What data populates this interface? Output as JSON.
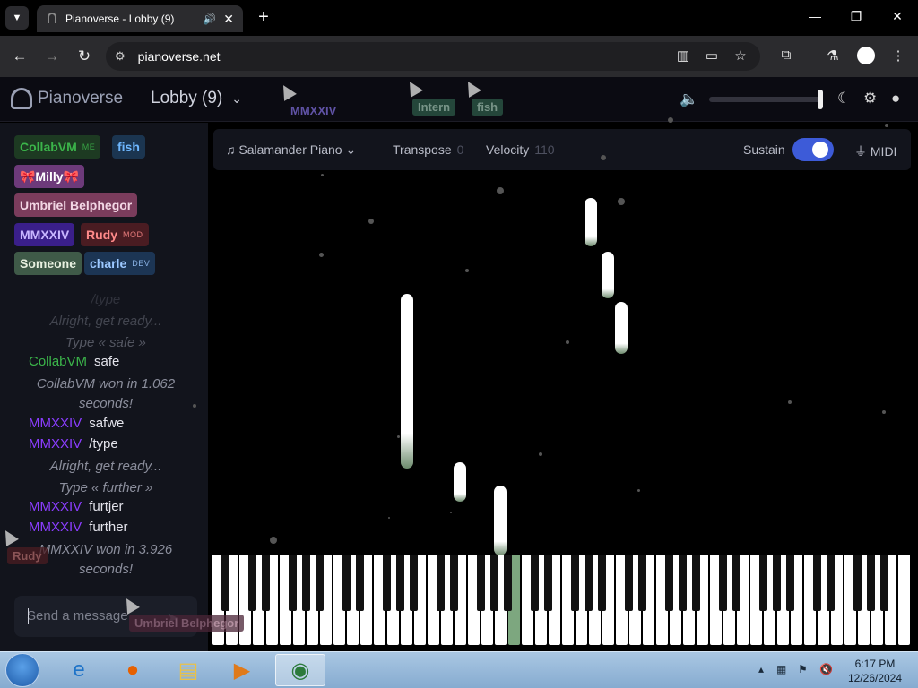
{
  "browser": {
    "tab_title": "Pianoverse - Lobby (9)",
    "url": "pianoverse.net",
    "new_tab_label": "+",
    "min_label": "—",
    "restore_label": "❐",
    "close_label": "✕"
  },
  "app": {
    "brand": "Pianoverse",
    "room": "Lobby (9)"
  },
  "users": [
    {
      "name": "CollabVM",
      "tag": "ME",
      "color": "#3bb44a",
      "bg": "#1d3a22"
    },
    {
      "name": "fish",
      "tag": "",
      "color": "#6fb8ff",
      "bg": "#1b3550"
    },
    {
      "name": "🎀Milly🎀",
      "tag": "",
      "color": "#ffffff",
      "bg": "#6d3a7a"
    },
    {
      "name": "Umbriel Belphegor",
      "tag": "",
      "color": "#f2d6e4",
      "bg": "#7a3c5c"
    },
    {
      "name": "MMXXIV",
      "tag": "",
      "color": "#c8b6ff",
      "bg": "#3a1f8a"
    },
    {
      "name": "Rudy",
      "tag": "MOD",
      "color": "#ff8a8a",
      "bg": "#4a1c22"
    },
    {
      "name": "Someone",
      "tag": "",
      "color": "#e8f0e0",
      "bg": "#3f5a48"
    },
    {
      "name": "charle",
      "tag": "DEV",
      "color": "#9cc8ff",
      "bg": "#1c3554"
    }
  ],
  "chat": {
    "faded": [
      "/type",
      "Alright, get ready...",
      "Type « safe »"
    ],
    "messages": [
      {
        "kind": "msg",
        "user": "CollabVM",
        "color": "#3bb44a",
        "text": "safe"
      },
      {
        "kind": "sys",
        "text": "CollabVM won in 1.062 seconds!"
      },
      {
        "kind": "msg",
        "user": "MMXXIV",
        "color": "#8b3dff",
        "text": "safwe"
      },
      {
        "kind": "msg",
        "user": "MMXXIV",
        "color": "#8b3dff",
        "text": "/type"
      },
      {
        "kind": "sys",
        "text": "Alright, get ready..."
      },
      {
        "kind": "sys",
        "text": "Type « further »"
      },
      {
        "kind": "msg",
        "user": "MMXXIV",
        "color": "#8b3dff",
        "text": "furtjer"
      },
      {
        "kind": "msg",
        "user": "MMXXIV",
        "color": "#8b3dff",
        "text": "further"
      },
      {
        "kind": "sys",
        "text": "MMXXIV won in 3.926 seconds!"
      }
    ],
    "placeholder": "Send a message"
  },
  "controls": {
    "instrument": "Salamander Piano",
    "transpose_label": "Transpose",
    "transpose_value": "0",
    "velocity_label": "Velocity",
    "velocity_value": "110",
    "sustain_label": "Sustain",
    "sustain_on": true,
    "midi_label": "MIDI"
  },
  "volume": 0.97,
  "cursors": [
    {
      "name": "MMXXIV",
      "color": "#5b3cc4"
    },
    {
      "name": "Intern",
      "color": "#3b6b56"
    },
    {
      "name": "fish",
      "color": "#3b6b56"
    },
    {
      "name": "Rudy",
      "color": "#7a2a2a"
    },
    {
      "name": "Umbriel Belphegor",
      "color": "#7a3c5c"
    }
  ],
  "taskbar": {
    "time": "6:17 PM",
    "date": "12/26/2024"
  }
}
